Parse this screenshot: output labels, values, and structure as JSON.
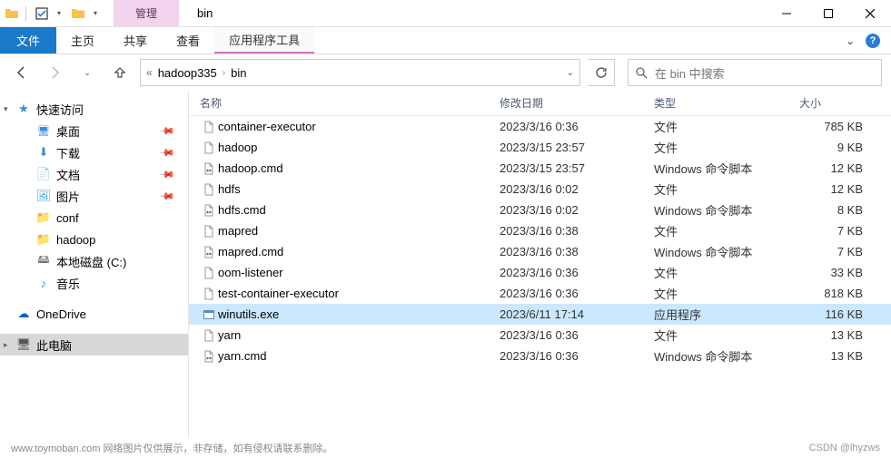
{
  "titlebar": {
    "manage": "管理",
    "title": "bin"
  },
  "ribbon": {
    "file": "文件",
    "home": "主页",
    "share": "共享",
    "view": "查看",
    "tools": "应用程序工具"
  },
  "breadcrumb": {
    "part1": "hadoop335",
    "part2": "bin"
  },
  "search": {
    "placeholder": "在 bin 中搜索"
  },
  "nav": {
    "quick_access": "快速访问",
    "desktop": "桌面",
    "downloads": "下载",
    "documents": "文档",
    "pictures": "图片",
    "conf": "conf",
    "hadoop": "hadoop",
    "local_disk": "本地磁盘 (C:)",
    "music": "音乐",
    "onedrive": "OneDrive",
    "this_pc": "此电脑"
  },
  "columns": {
    "name": "名称",
    "date": "修改日期",
    "type": "类型",
    "size": "大小"
  },
  "types": {
    "file": "文件",
    "cmd": "Windows 命令脚本",
    "exe": "应用程序"
  },
  "files": [
    {
      "icon": "file",
      "name": "container-executor",
      "date": "2023/3/16 0:36",
      "type_key": "file",
      "size": "785 KB"
    },
    {
      "icon": "file",
      "name": "hadoop",
      "date": "2023/3/15 23:57",
      "type_key": "file",
      "size": "9 KB"
    },
    {
      "icon": "cmd",
      "name": "hadoop.cmd",
      "date": "2023/3/15 23:57",
      "type_key": "cmd",
      "size": "12 KB"
    },
    {
      "icon": "file",
      "name": "hdfs",
      "date": "2023/3/16 0:02",
      "type_key": "file",
      "size": "12 KB"
    },
    {
      "icon": "cmd",
      "name": "hdfs.cmd",
      "date": "2023/3/16 0:02",
      "type_key": "cmd",
      "size": "8 KB"
    },
    {
      "icon": "file",
      "name": "mapred",
      "date": "2023/3/16 0:38",
      "type_key": "file",
      "size": "7 KB"
    },
    {
      "icon": "cmd",
      "name": "mapred.cmd",
      "date": "2023/3/16 0:38",
      "type_key": "cmd",
      "size": "7 KB"
    },
    {
      "icon": "file",
      "name": "oom-listener",
      "date": "2023/3/16 0:36",
      "type_key": "file",
      "size": "33 KB"
    },
    {
      "icon": "file",
      "name": "test-container-executor",
      "date": "2023/3/16 0:36",
      "type_key": "file",
      "size": "818 KB"
    },
    {
      "icon": "exe",
      "name": "winutils.exe",
      "date": "2023/6/11 17:14",
      "type_key": "exe",
      "size": "116 KB",
      "selected": true
    },
    {
      "icon": "file",
      "name": "yarn",
      "date": "2023/3/16 0:36",
      "type_key": "file",
      "size": "13 KB"
    },
    {
      "icon": "cmd",
      "name": "yarn.cmd",
      "date": "2023/3/16 0:36",
      "type_key": "cmd",
      "size": "13 KB"
    }
  ],
  "footer": {
    "watermark": "www.toymoban.com  网络图片仅供展示，非存储，如有侵权请联系删除。",
    "credit": "CSDN @lhyzws"
  }
}
